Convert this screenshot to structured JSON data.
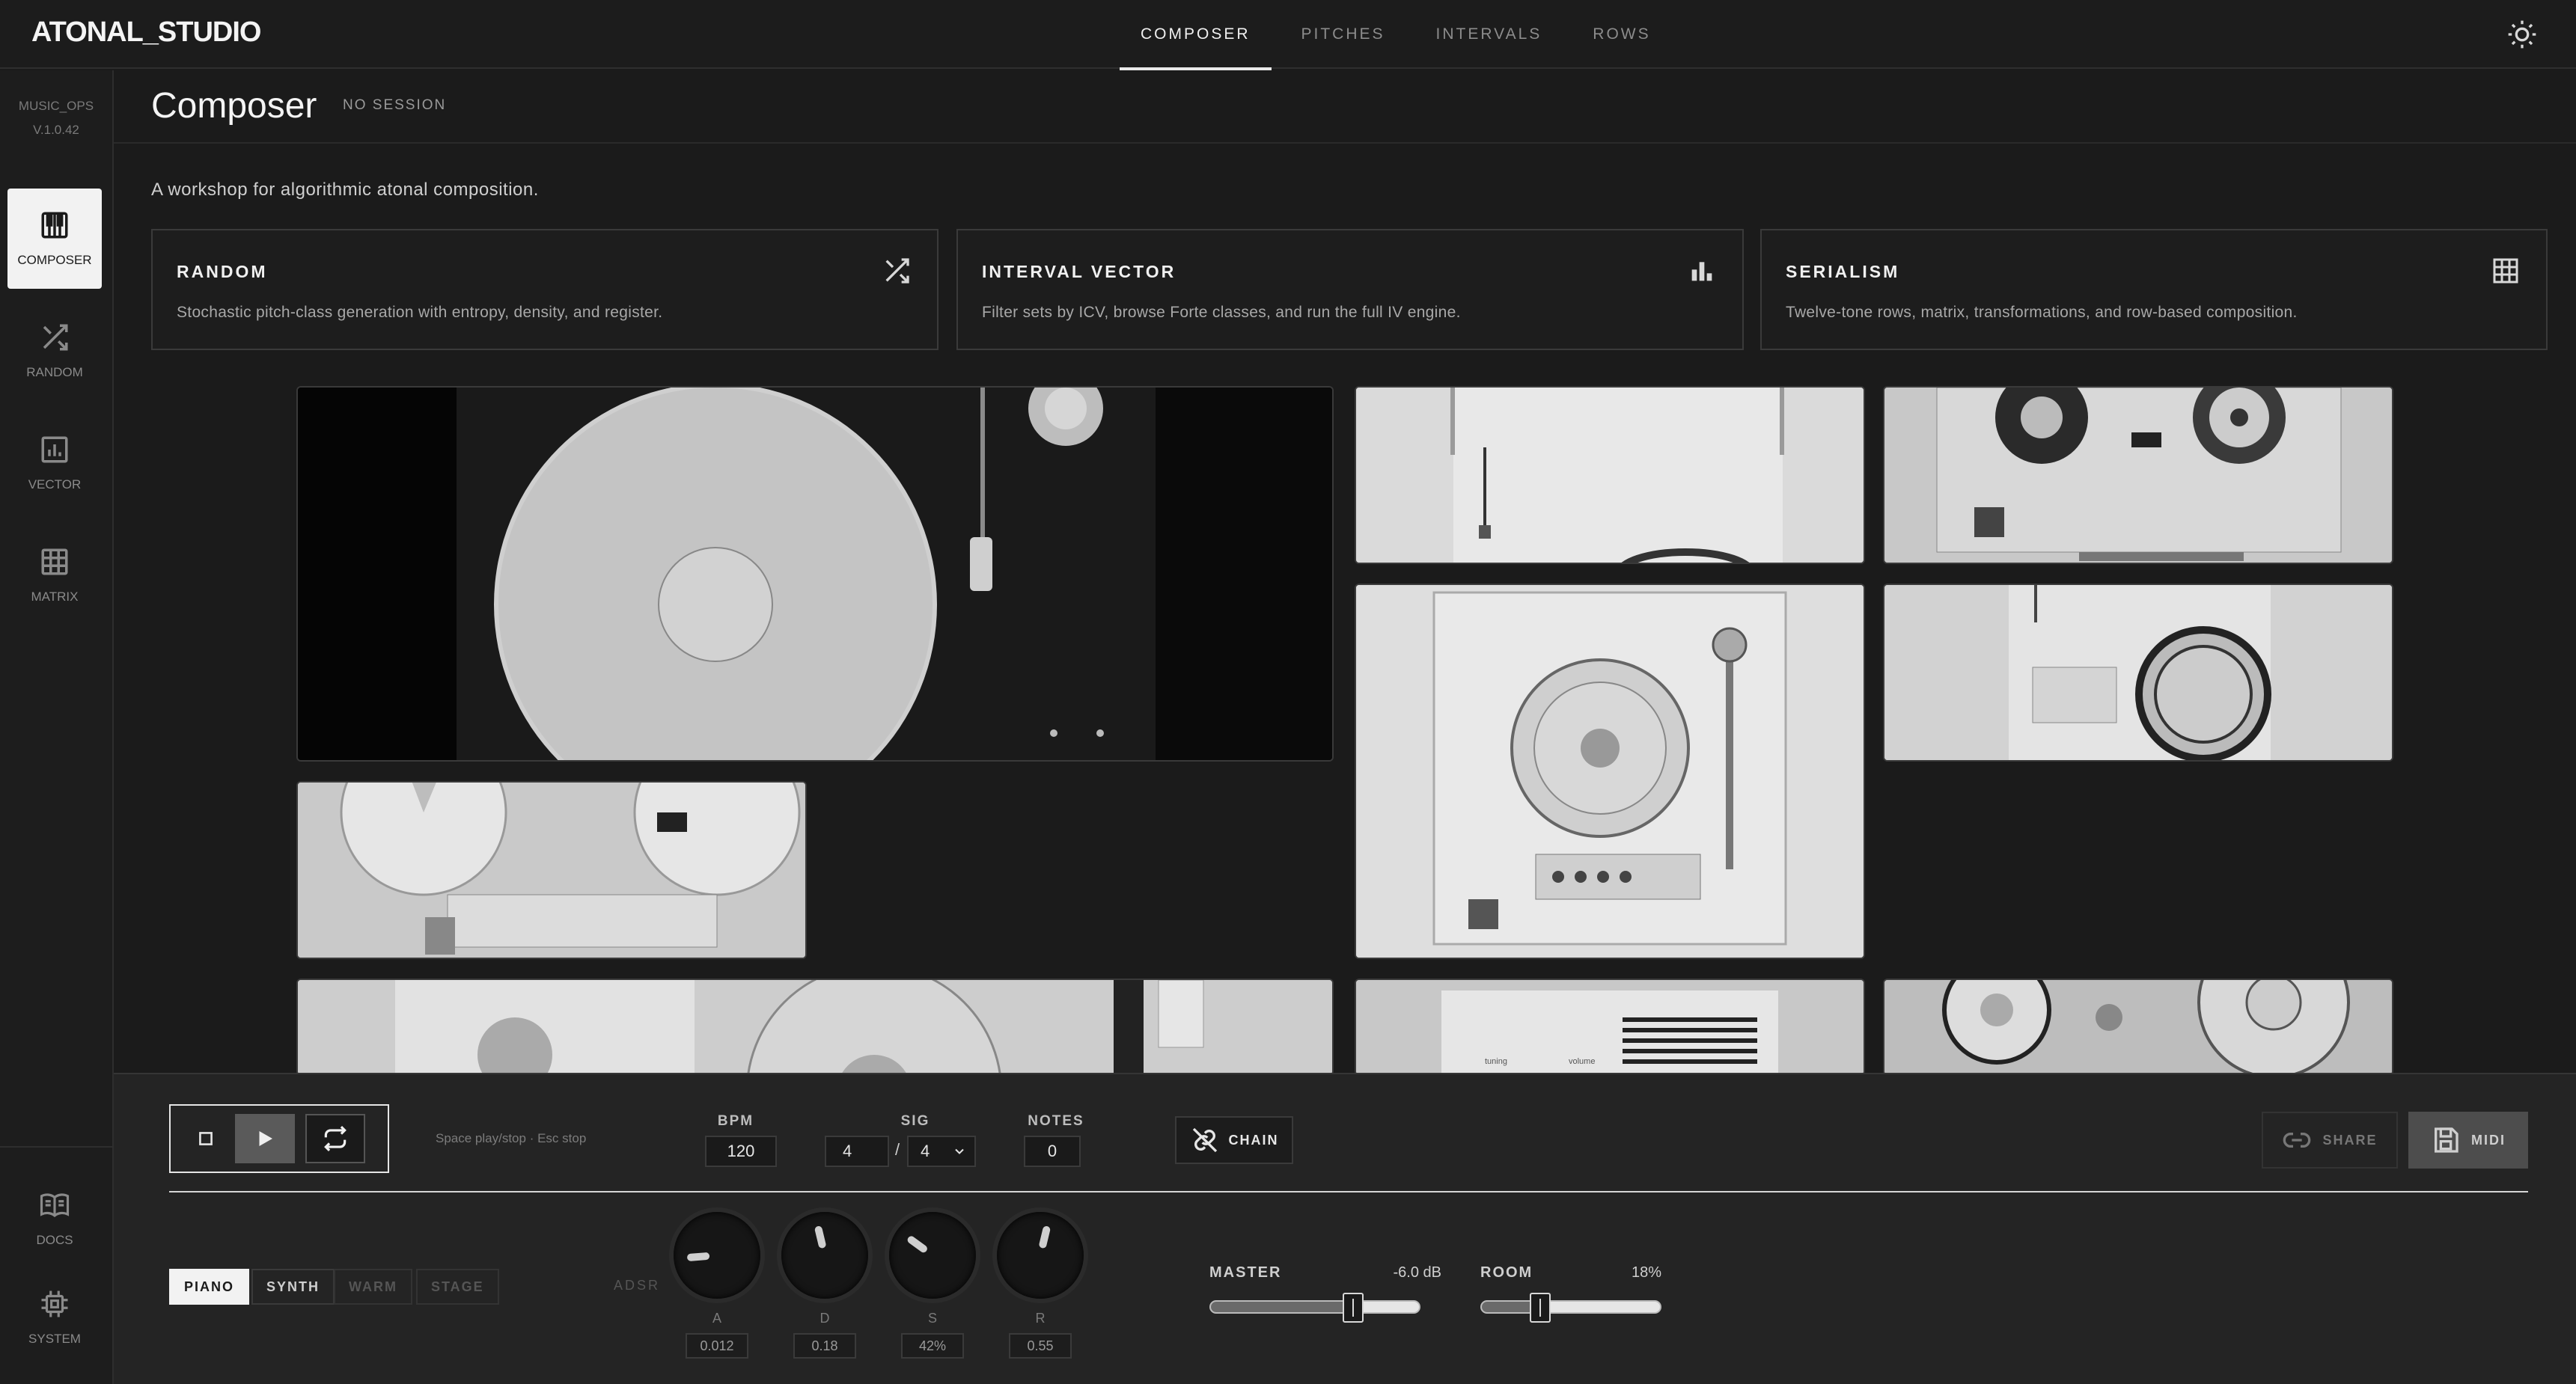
{
  "app": {
    "name": "ATONAL_STUDIO"
  },
  "top_nav": {
    "tabs": [
      {
        "label": "COMPOSER",
        "active": true
      },
      {
        "label": "PITCHES",
        "active": false
      },
      {
        "label": "INTERVALS",
        "active": false
      },
      {
        "label": "ROWS",
        "active": false
      }
    ],
    "theme_icon": "sun-icon"
  },
  "sidebar": {
    "meta_line1": "MUSIC_OPS",
    "meta_line2": "V.1.0.42",
    "items": [
      {
        "label": "COMPOSER",
        "icon": "piano-icon",
        "active": true
      },
      {
        "label": "RANDOM",
        "icon": "shuffle-icon",
        "active": false
      },
      {
        "label": "VECTOR",
        "icon": "bar-chart-icon",
        "active": false
      },
      {
        "label": "MATRIX",
        "icon": "grid-icon",
        "active": false
      }
    ],
    "bottom_items": [
      {
        "label": "DOCS",
        "icon": "book-icon"
      },
      {
        "label": "SYSTEM",
        "icon": "chip-icon"
      }
    ]
  },
  "page": {
    "title": "Composer",
    "session": "NO SESSION",
    "description": "A workshop for algorithmic atonal composition."
  },
  "cards": [
    {
      "title": "RANDOM",
      "description": "Stochastic pitch-class generation with entropy, density, and register.",
      "icon": "shuffle-icon"
    },
    {
      "title": "INTERVAL VECTOR",
      "description": "Filter sets by ICV, browse Forte classes, and run the full IV engine.",
      "icon": "bar-chart-icon"
    },
    {
      "title": "SERIALISM",
      "description": "Twelve-tone rows, matrix, transformations, and row-based composition.",
      "icon": "grid-icon"
    }
  ],
  "gallery": {
    "tiles": [
      "turntable-hero",
      "radio-panel",
      "reel-to-reel",
      "turntable-plexiglass",
      "radio-speaker",
      "reel-tape-deck",
      "turntable-long",
      "radio-tuning",
      "reel-tape-closeup"
    ],
    "tuning_label": "tuning",
    "volume_label": "volume"
  },
  "transport": {
    "hint": "Space play/stop · Esc stop",
    "bpm_label": "BPM",
    "bpm": "120",
    "sig_label": "SIG",
    "sig_num": "4",
    "sig_sep": "/",
    "sig_den": "4",
    "notes_label": "NOTES",
    "notes": "0",
    "chain_label": "CHAIN",
    "share_label": "SHARE",
    "midi_label": "MIDI"
  },
  "presets": [
    {
      "label": "PIANO",
      "state": "active"
    },
    {
      "label": "SYNTH",
      "state": "enabled"
    },
    {
      "label": "WARM",
      "state": "dim"
    },
    {
      "label": "STAGE",
      "state": "dim"
    }
  ],
  "adsr": {
    "label": "ADSR",
    "knobs": [
      {
        "name": "A",
        "value": "0.012",
        "level": 0.15
      },
      {
        "name": "D",
        "value": "0.18",
        "level": 0.45
      },
      {
        "name": "S",
        "value": "42%",
        "level": 0.3
      },
      {
        "name": "R",
        "value": "0.55",
        "level": 0.55
      }
    ]
  },
  "mixer": {
    "master_label": "MASTER",
    "master_value": "-6.0 dB",
    "master_level": 0.68,
    "room_label": "ROOM",
    "room_value": "18%",
    "room_level": 0.33
  }
}
